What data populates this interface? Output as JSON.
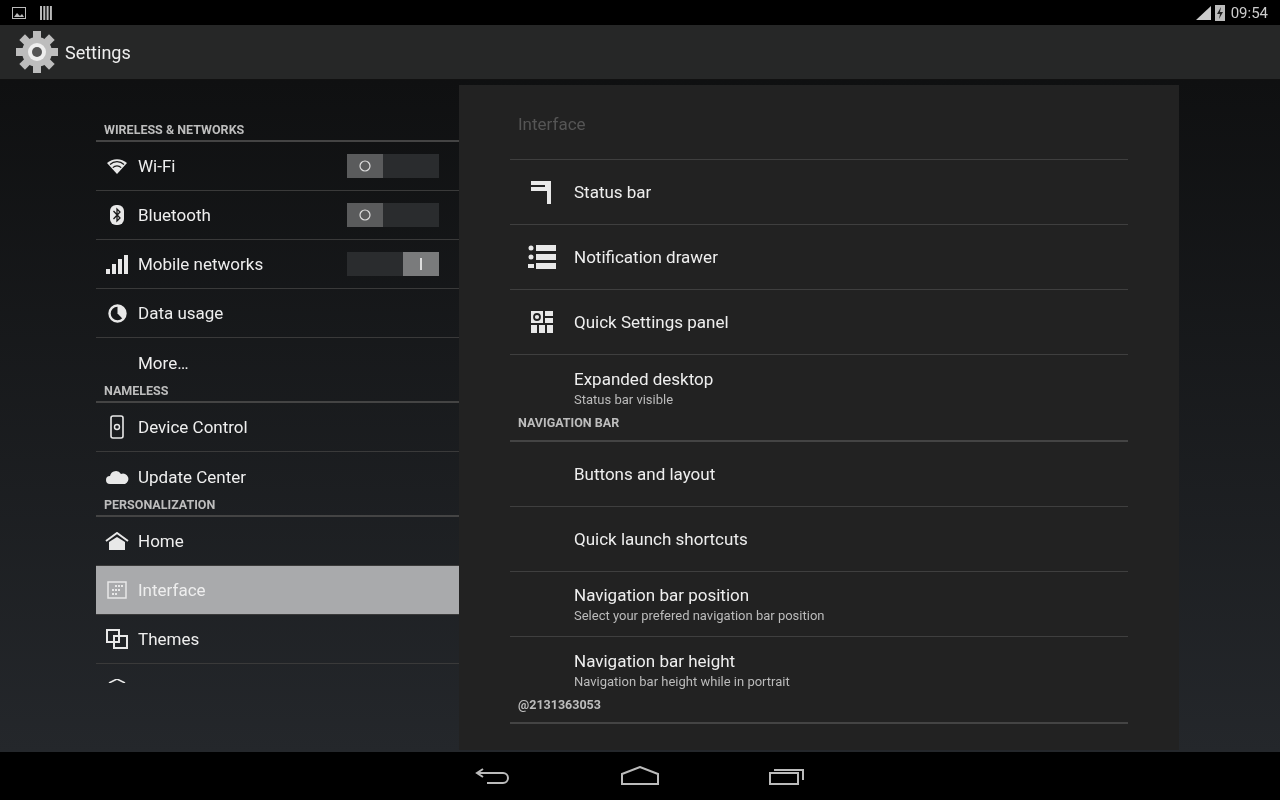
{
  "status_bar": {
    "time": "09:54"
  },
  "action_bar": {
    "title": "Settings"
  },
  "sidebar": {
    "sections": [
      {
        "header": "WIRELESS & NETWORKS",
        "items": [
          {
            "label": "Wi-Fi",
            "kind": "toggle",
            "on": false,
            "selected": false
          },
          {
            "label": "Bluetooth",
            "kind": "toggle",
            "on": false,
            "selected": false
          },
          {
            "label": "Mobile networks",
            "kind": "toggle",
            "on": true,
            "selected": false
          },
          {
            "label": "Data usage",
            "kind": "plain",
            "selected": false
          },
          {
            "label": "More…",
            "kind": "plain",
            "selected": false
          }
        ]
      },
      {
        "header": "NAMELESS",
        "items": [
          {
            "label": "Device Control",
            "kind": "plain",
            "selected": false
          },
          {
            "label": "Update Center",
            "kind": "plain",
            "selected": false
          }
        ]
      },
      {
        "header": "PERSONALIZATION",
        "items": [
          {
            "label": "Home",
            "kind": "plain",
            "selected": false
          },
          {
            "label": "Interface",
            "kind": "plain",
            "selected": true
          },
          {
            "label": "Themes",
            "kind": "plain",
            "selected": false
          }
        ]
      }
    ]
  },
  "panel": {
    "title": "Interface",
    "sections": [
      {
        "items": [
          {
            "title": "Status bar"
          },
          {
            "title": "Notification drawer"
          },
          {
            "title": "Quick Settings panel"
          },
          {
            "title": "Expanded desktop",
            "summary": "Status bar visible"
          }
        ]
      },
      {
        "header": "NAVIGATION BAR",
        "items": [
          {
            "title": "Buttons and layout"
          },
          {
            "title": "Quick launch shortcuts"
          },
          {
            "title": "Navigation bar position",
            "summary": "Select your prefered navigation bar position"
          },
          {
            "title": "Navigation bar height",
            "summary": "Navigation bar height while in portrait"
          }
        ]
      },
      {
        "header": "@2131363053"
      }
    ]
  }
}
